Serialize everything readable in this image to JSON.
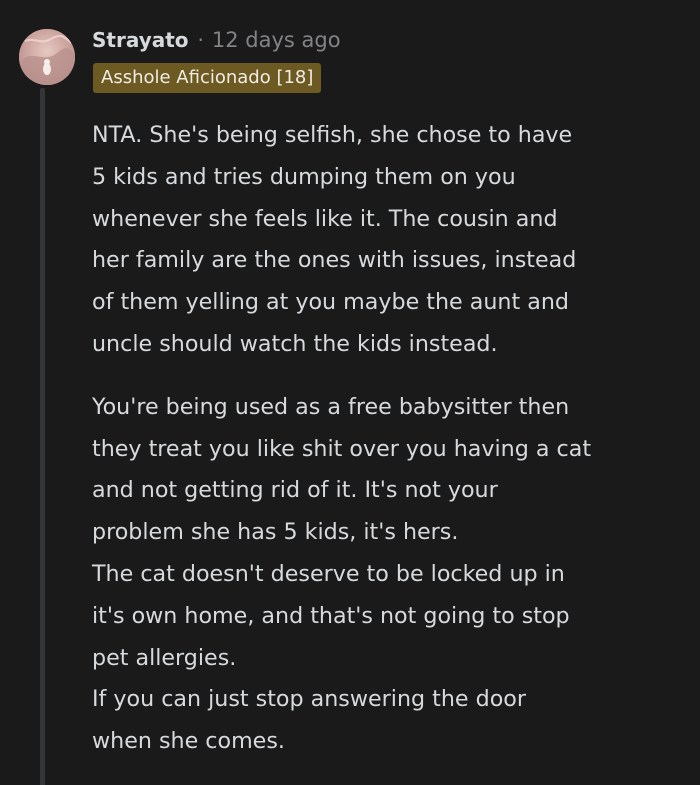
{
  "comment": {
    "author": "Strayato",
    "separator": "·",
    "timestamp": "12 days ago",
    "flair": "Asshole Aficionado [18]",
    "avatar_icon": "user-avatar",
    "flair_color": "#6d5a23",
    "paragraphs": [
      "NTA. She's being selfish, she chose to have\n5 kids and tries dumping them on you\nwhenever she feels like it. The cousin and\nher family are the ones with issues, instead\nof them yelling at you maybe the aunt and\nuncle should watch the kids instead.",
      "You're being used as a free babysitter then\nthey treat you like shit over you having a cat\nand not getting rid of it. It's not your\nproblem she has 5 kids, it's hers.\nThe cat doesn't deserve to be locked up in\nit's own home, and that's not going to stop\npet allergies.\nIf you can just stop answering the door\nwhen she comes."
    ]
  }
}
